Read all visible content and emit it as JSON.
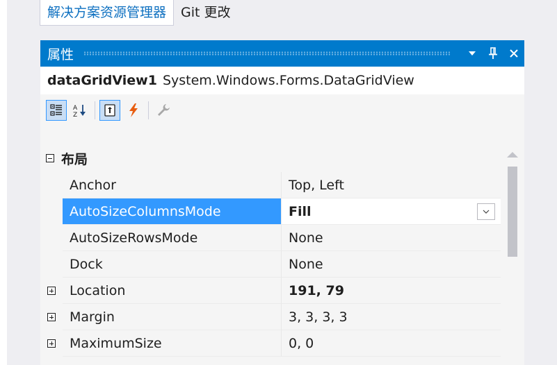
{
  "tabs": [
    {
      "label": "解决方案资源管理器"
    },
    {
      "label": "Git 更改"
    }
  ],
  "panel": {
    "title": "属性",
    "title_buttons": [
      "dropdown-arrow-icon",
      "pin-icon",
      "close-icon"
    ],
    "object": {
      "name": "dataGridView1",
      "type": "System.Windows.Forms.DataGridView"
    },
    "toolbar": [
      "categorized-icon",
      "alphabetical-icon",
      "properties-icon",
      "events-icon",
      "property-pages-icon"
    ]
  },
  "grid": {
    "category": {
      "label": "布局",
      "expanded": true
    },
    "rows": [
      {
        "name": "Anchor",
        "value": "Top, Left",
        "bold": false,
        "expandable": false
      },
      {
        "name": "AutoSizeColumnsMode",
        "value": "Fill",
        "bold": true,
        "expandable": false,
        "selected": true
      },
      {
        "name": "AutoSizeRowsMode",
        "value": "None",
        "bold": false,
        "expandable": false
      },
      {
        "name": "Dock",
        "value": "None",
        "bold": false,
        "expandable": false
      },
      {
        "name": "Location",
        "value": "191, 79",
        "bold": true,
        "expandable": true
      },
      {
        "name": "Margin",
        "value": "3, 3, 3, 3",
        "bold": false,
        "expandable": true
      },
      {
        "name": "MaximumSize",
        "value": "0, 0",
        "bold": false,
        "expandable": true
      }
    ]
  },
  "colors": {
    "accent": "#007acc",
    "selection": "#3399ff",
    "tab_active_text": "#0e70c0"
  }
}
